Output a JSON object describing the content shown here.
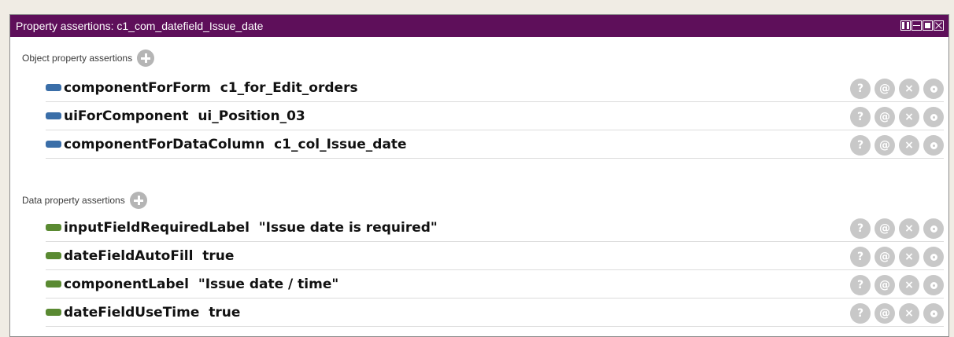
{
  "panel": {
    "title": "Property assertions: c1_com_datefield_Issue_date"
  },
  "object_section": {
    "label": "Object property assertions",
    "rows": [
      {
        "text": "componentForForm  c1_for_Edit_orders"
      },
      {
        "text": "uiForComponent  ui_Position_03"
      },
      {
        "text": "componentForDataColumn  c1_col_Issue_date"
      }
    ]
  },
  "data_section": {
    "label": "Data property assertions",
    "rows": [
      {
        "text": "inputFieldRequiredLabel  \"Issue date is required\""
      },
      {
        "text": "dateFieldAutoFill  true"
      },
      {
        "text": "componentLabel  \"Issue date / time\""
      },
      {
        "text": "dateFieldUseTime  true"
      }
    ]
  },
  "row_buttons": {
    "help": "?",
    "annotate": "@",
    "delete": "×"
  },
  "colors": {
    "titlebar": "#5e0f5a",
    "object_marker": "#3a6ea8",
    "data_marker": "#5a8a32",
    "button_grey": "#c8c8c8"
  }
}
